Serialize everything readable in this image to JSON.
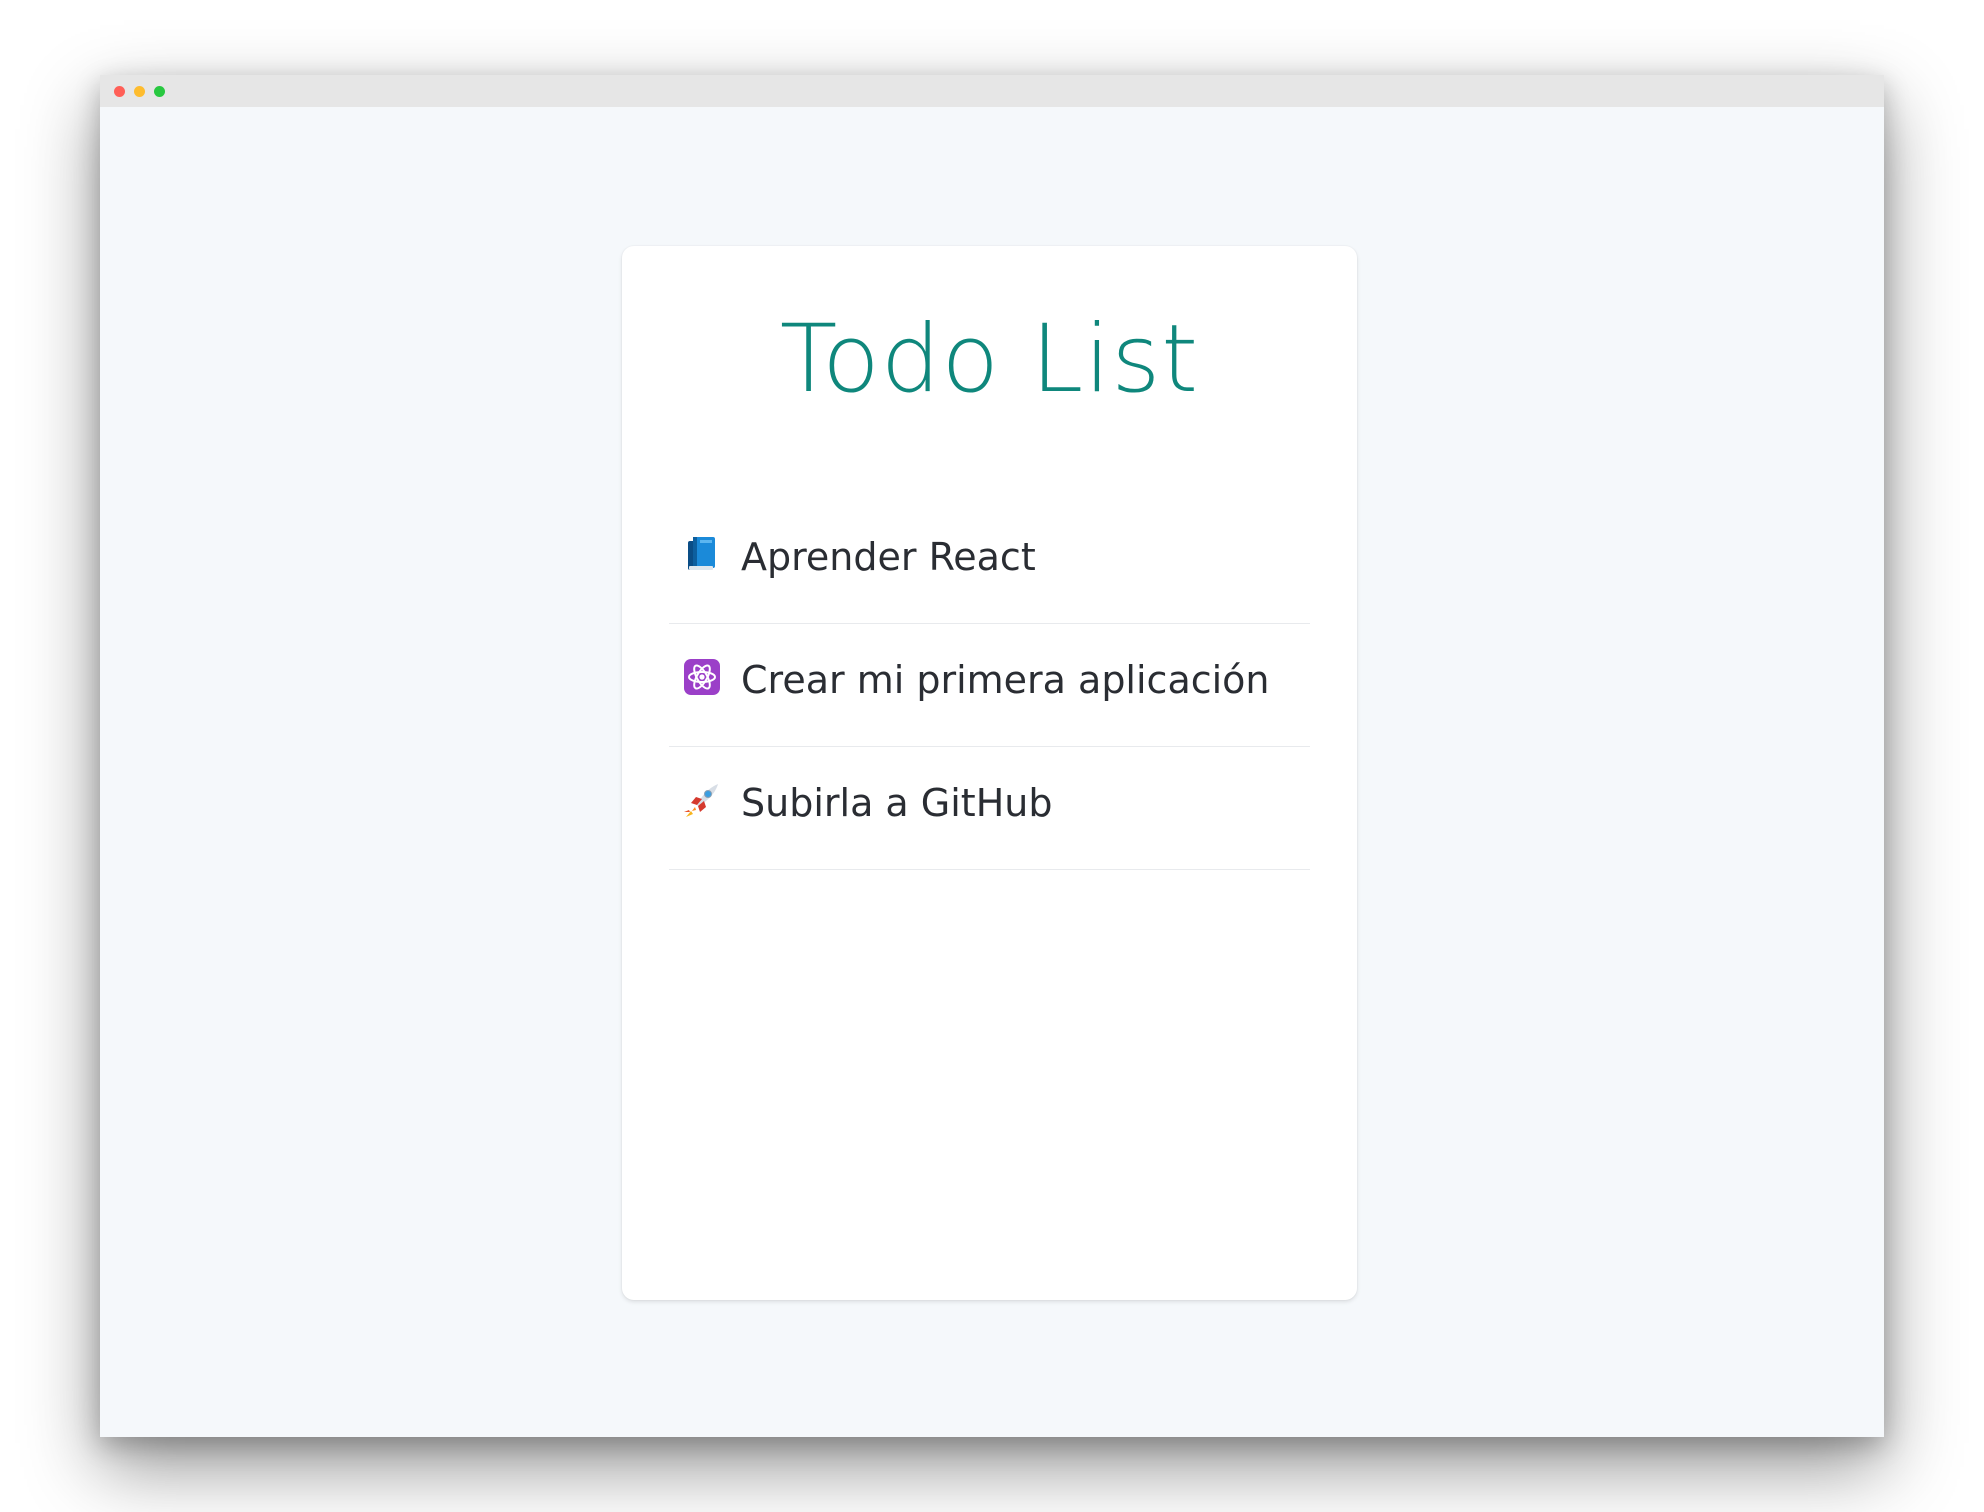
{
  "window": {
    "controls": [
      "close",
      "minimize",
      "maximize"
    ]
  },
  "app": {
    "title": "Todo List",
    "accent_color": "#0f877c"
  },
  "todos": [
    {
      "icon": "blue-book-icon",
      "label": "Aprender React"
    },
    {
      "icon": "atom-icon",
      "label": "Crear mi primera aplicación"
    },
    {
      "icon": "rocket-icon",
      "label": "Subirla a GitHub"
    }
  ]
}
